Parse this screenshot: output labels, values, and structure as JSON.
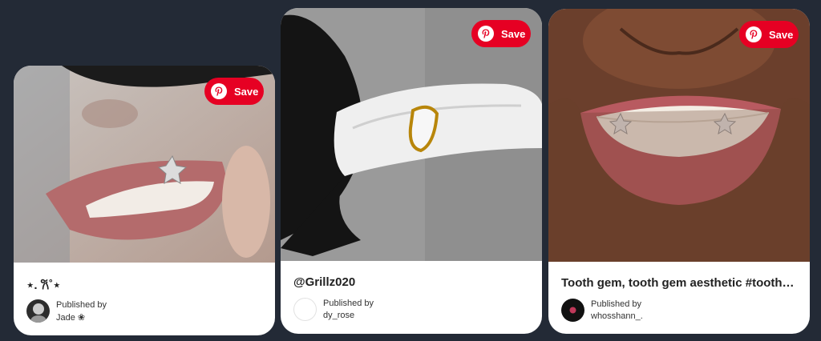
{
  "cards": [
    {
      "save_label": "Save",
      "caption": "⋆. 𐙚˚⋆",
      "published_by_label": "Published by",
      "publisher": "Jade ❀",
      "avatar_color": "#2d2d2d"
    },
    {
      "save_label": "Save",
      "caption": "@Grillz020",
      "published_by_label": "Published by",
      "publisher": "dy_rose",
      "avatar_color": "#ffffff"
    },
    {
      "save_label": "Save",
      "caption": "Tooth gem, tooth gem aesthetic #tooth…",
      "published_by_label": "Published by",
      "publisher": "whosshann_.",
      "avatar_color": "#111111"
    }
  ],
  "colors": {
    "background": "#232a36",
    "save_button": "#e60023",
    "card": "#ffffff"
  }
}
